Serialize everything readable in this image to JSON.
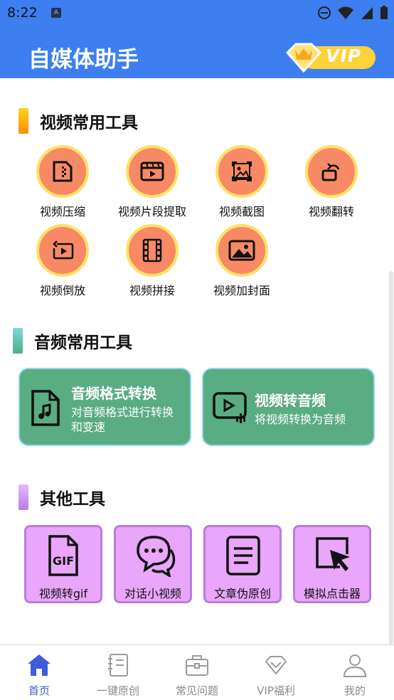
{
  "status_bar": {
    "time": "8:22",
    "app_indicator": "A"
  },
  "app_bar": {
    "title": "自媒体助手",
    "vip_label": "VIP"
  },
  "video_tools": {
    "section_title": "视频常用工具",
    "items": [
      {
        "label": "视频压缩",
        "icon": "compress-icon"
      },
      {
        "label": "视频片段提取",
        "icon": "clip-extract-icon"
      },
      {
        "label": "视频截图",
        "icon": "screenshot-icon"
      },
      {
        "label": "视频翻转",
        "icon": "rotate-icon"
      },
      {
        "label": "视频倒放",
        "icon": "reverse-icon"
      },
      {
        "label": "视频拼接",
        "icon": "film-join-icon"
      },
      {
        "label": "视频加封面",
        "icon": "cover-image-icon"
      }
    ]
  },
  "audio_tools": {
    "section_title": "音频常用工具",
    "cards": [
      {
        "title": "音频格式转换",
        "desc_line1": "对音频格式进行转换",
        "desc_line2": "和变速",
        "icon": "music-file-icon"
      },
      {
        "title": "视频转音频",
        "desc_line1": "将视频转换为音频",
        "icon": "video-to-audio-icon"
      }
    ]
  },
  "other_tools": {
    "section_title": "其他工具",
    "items": [
      {
        "label": "视频转gif",
        "icon": "gif-file-icon",
        "badge": "GIF"
      },
      {
        "label": "对话小视频",
        "icon": "chat-bubbles-icon"
      },
      {
        "label": "文章伪原创",
        "icon": "document-icon"
      },
      {
        "label": "模拟点击器",
        "icon": "cursor-click-icon"
      }
    ]
  },
  "bottom_nav": {
    "items": [
      {
        "label": "首页",
        "icon": "home-icon",
        "active": true
      },
      {
        "label": "一键原创",
        "icon": "notebook-icon"
      },
      {
        "label": "常见问题",
        "icon": "briefcase-icon"
      },
      {
        "label": "VIP福利",
        "icon": "diamond-icon"
      },
      {
        "label": "我的",
        "icon": "user-icon"
      }
    ]
  },
  "colors": {
    "app_bar": "#3d7ff0",
    "tool_circle": "#f78a64",
    "tool_ring": "#fbe26a",
    "audio_card": "#5aac83",
    "other_card": "#e9a6fb",
    "nav_active": "#3f5bd8"
  }
}
